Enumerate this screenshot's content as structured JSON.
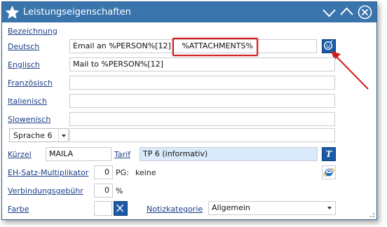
{
  "window": {
    "title": "Leistungseigenschaften"
  },
  "labels": {
    "bezeichnung": "Bezeichnung",
    "deutsch": "Deutsch",
    "englisch": "Englisch",
    "franzoesisch": "Französisch",
    "italienisch": "Italienisch",
    "slowenisch": "Slowenisch",
    "kurzel": "Kürzel",
    "tarif": "Tarif",
    "eh_multiplikator": "EH-Satz-Multiplikator",
    "pg": "PG:",
    "pg_value": "keine",
    "verbindungsgebuehr": "Verbindungsgebühr",
    "percent": "%",
    "farbe": "Farbe",
    "notizkategorie": "Notizkategorie"
  },
  "fields": {
    "deutsch_part1": "Email an %PERSON%[12]",
    "deutsch_part2": "%ATTACHMENTS%",
    "englisch": "Mail to %PERSON%[12]",
    "franzoesisch": "",
    "italienisch": "",
    "slowenisch": "",
    "sprache6_value": "",
    "kurzel": "MAILA",
    "tarif": "TP 6 (informativ)",
    "eh_multiplikator": "0",
    "verbindungsgebuehr": "0",
    "notizkategorie": "Allgemein"
  },
  "sprache_select": {
    "selected": "Sprache 6"
  },
  "tarif_button_label": "T",
  "colors": {
    "titlebar": "#3a74ad",
    "accent_blue": "#1b5aa6",
    "highlight_red": "#d31d1d",
    "tarif_bg": "#d9ebfb"
  },
  "icons": {
    "app": "star-icon",
    "minimize": "chevron-down-icon",
    "maximize": "chevron-up-icon",
    "close": "close-icon",
    "placeholder_picker": "smiley-clock-icon",
    "ie": "internet-explorer-icon",
    "color_clear": "x-icon"
  }
}
